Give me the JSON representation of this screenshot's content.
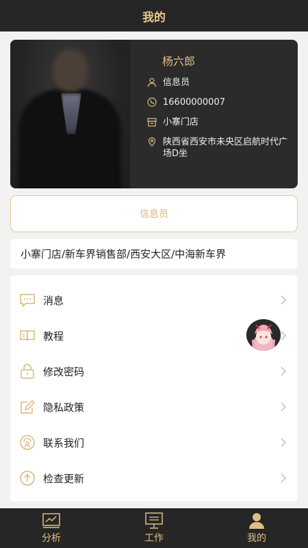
{
  "header": {
    "title": "我的"
  },
  "profile": {
    "name": "杨六郎",
    "role": "信息员",
    "phone": "16600000007",
    "store": "小寨门店",
    "address": "陕西省西安市未央区启航时代广场D坐"
  },
  "role_box": {
    "label": "信息员"
  },
  "org_path": "小寨门店/新车界销售部/西安大区/中海新车界",
  "menu": {
    "items": [
      {
        "label": "消息",
        "icon": "message-icon"
      },
      {
        "label": "教程",
        "icon": "book-icon"
      },
      {
        "label": "修改密码",
        "icon": "lock-icon"
      },
      {
        "label": "隐私政策",
        "icon": "edit-icon"
      },
      {
        "label": "联系我们",
        "icon": "support-icon"
      },
      {
        "label": "检查更新",
        "icon": "upload-icon"
      }
    ]
  },
  "tabbar": {
    "tabs": [
      {
        "label": "分析",
        "icon": "chart-icon"
      },
      {
        "label": "工作",
        "icon": "monitor-icon"
      },
      {
        "label": "我的",
        "icon": "user-icon",
        "active": true
      }
    ]
  },
  "colors": {
    "accent": "#e0be82",
    "dark": "#262626"
  }
}
